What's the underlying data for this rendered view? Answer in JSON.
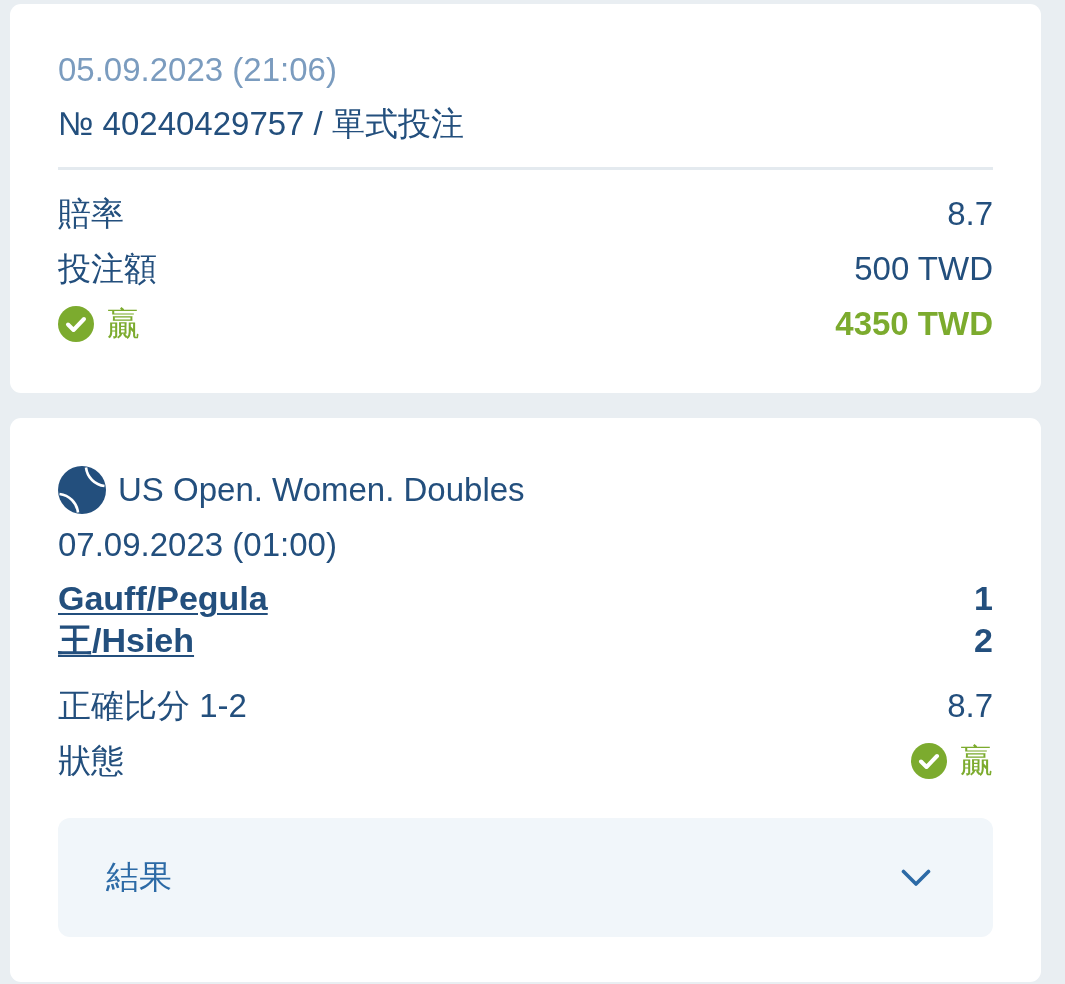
{
  "bet": {
    "date": "05.09.2023 (21:06)",
    "number": "№ 40240429757 / 單式投注",
    "rows": [
      {
        "kind": "plain",
        "label": "賠率",
        "value": "8.7"
      },
      {
        "kind": "plain",
        "label": "投注額",
        "value": "500 TWD"
      },
      {
        "kind": "outcome",
        "label": "贏",
        "value": "4350 TWD",
        "won": true
      }
    ]
  },
  "event": {
    "title": "US Open. Women. Doubles",
    "date": "07.09.2023 (01:00)",
    "teams": [
      {
        "name": "Gauff/Pegula",
        "score": "1"
      },
      {
        "name": "王/Hsieh",
        "score": "2"
      }
    ],
    "rows": [
      {
        "kind": "plain",
        "label": "正確比分 1-2",
        "value": "8.7"
      },
      {
        "kind": "outcome",
        "label": "狀態",
        "value": "贏",
        "won": true
      }
    ]
  },
  "results_panel": {
    "label": "結果",
    "expanded": false
  }
}
